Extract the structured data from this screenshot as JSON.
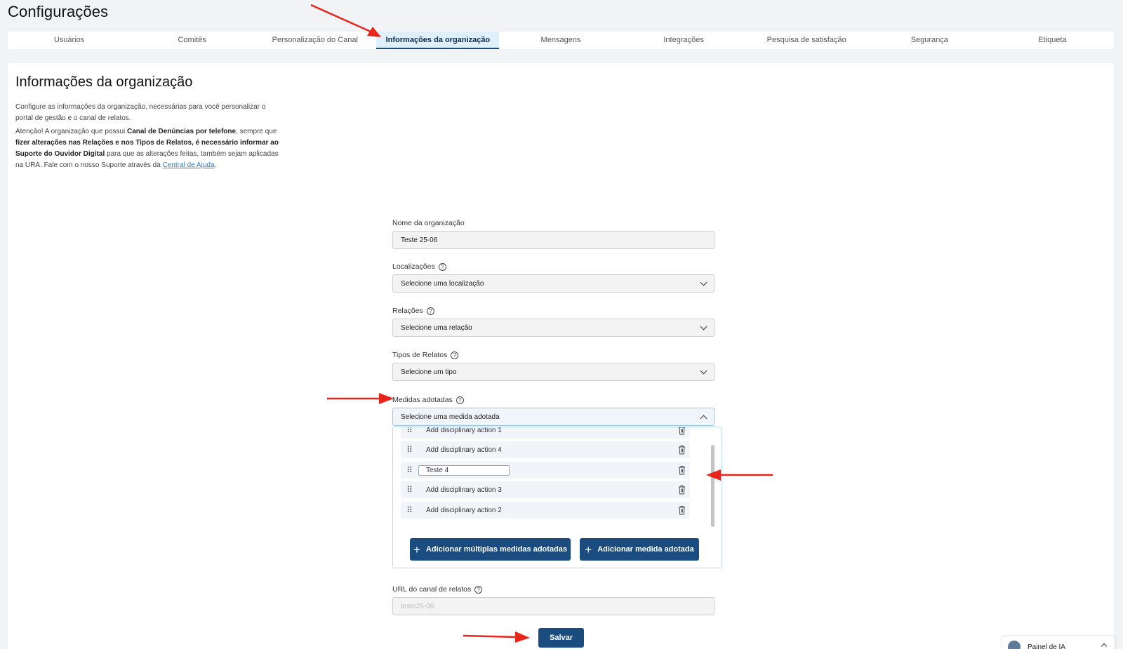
{
  "page_title": "Configurações",
  "tabs": [
    {
      "label": "Usuários"
    },
    {
      "label": "Comitês"
    },
    {
      "label": "Personalização do Canal"
    },
    {
      "label": "Informações da organização"
    },
    {
      "label": "Mensagens"
    },
    {
      "label": "Integrações"
    },
    {
      "label": "Pesquisa de satisfação"
    },
    {
      "label": "Segurança"
    },
    {
      "label": "Etiqueta"
    }
  ],
  "section": {
    "title": "Informações da organização",
    "desc1": "Configure as informações da organização, necessárias para você personalizar o portal de gestão e o canal de relatos.",
    "desc2_a": "Atenção! A organização que possui ",
    "desc2_b": "Canal de Denúncias por telefone",
    "desc2_c": ", sempre que ",
    "desc2_d": "fizer alterações nas Relações e nos Tipos de Relatos, é necessário informar ao Suporte do Ouvidor Digital",
    "desc2_e": " para que as alterações feitas, também sejam aplicadas na URA. Fale com o nosso Suporte através da ",
    "desc2_link": "Central de Ajuda",
    "desc2_end": "."
  },
  "form": {
    "org_name_label": "Nome da organização",
    "org_name_value": "Teste 25-06",
    "locations_label": "Localizações",
    "locations_placeholder": "Selecione uma localização",
    "relations_label": "Relações",
    "relations_placeholder": "Selecione uma relação",
    "report_types_label": "Tipos de Relatos",
    "report_types_placeholder": "Selecione um tipo",
    "measures_label": "Medidas adotadas",
    "measures_placeholder": "Selecione uma medida adotada",
    "url_label": "URL do canal de relatos",
    "url_value": "teste25-06",
    "help_glyph": "?"
  },
  "measures_list": [
    {
      "text": "Add disciplinary action 1"
    },
    {
      "text": "Add disciplinary action 4"
    },
    {
      "text": "Teste 4",
      "editing": true
    },
    {
      "text": "Add disciplinary action 3"
    },
    {
      "text": "Add disciplinary action 2"
    }
  ],
  "buttons": {
    "add_multiple": "Adicionar múltiplas medidas adotadas",
    "add_single": "Adicionar medida adotada",
    "save": "Salvar",
    "plus": "+"
  },
  "ia_panel": {
    "label": "Painel de IA"
  },
  "colors": {
    "primary": "#1a4c7f",
    "annotation_arrow": "#e8251a",
    "active_tab_bg": "#dff0fb"
  }
}
